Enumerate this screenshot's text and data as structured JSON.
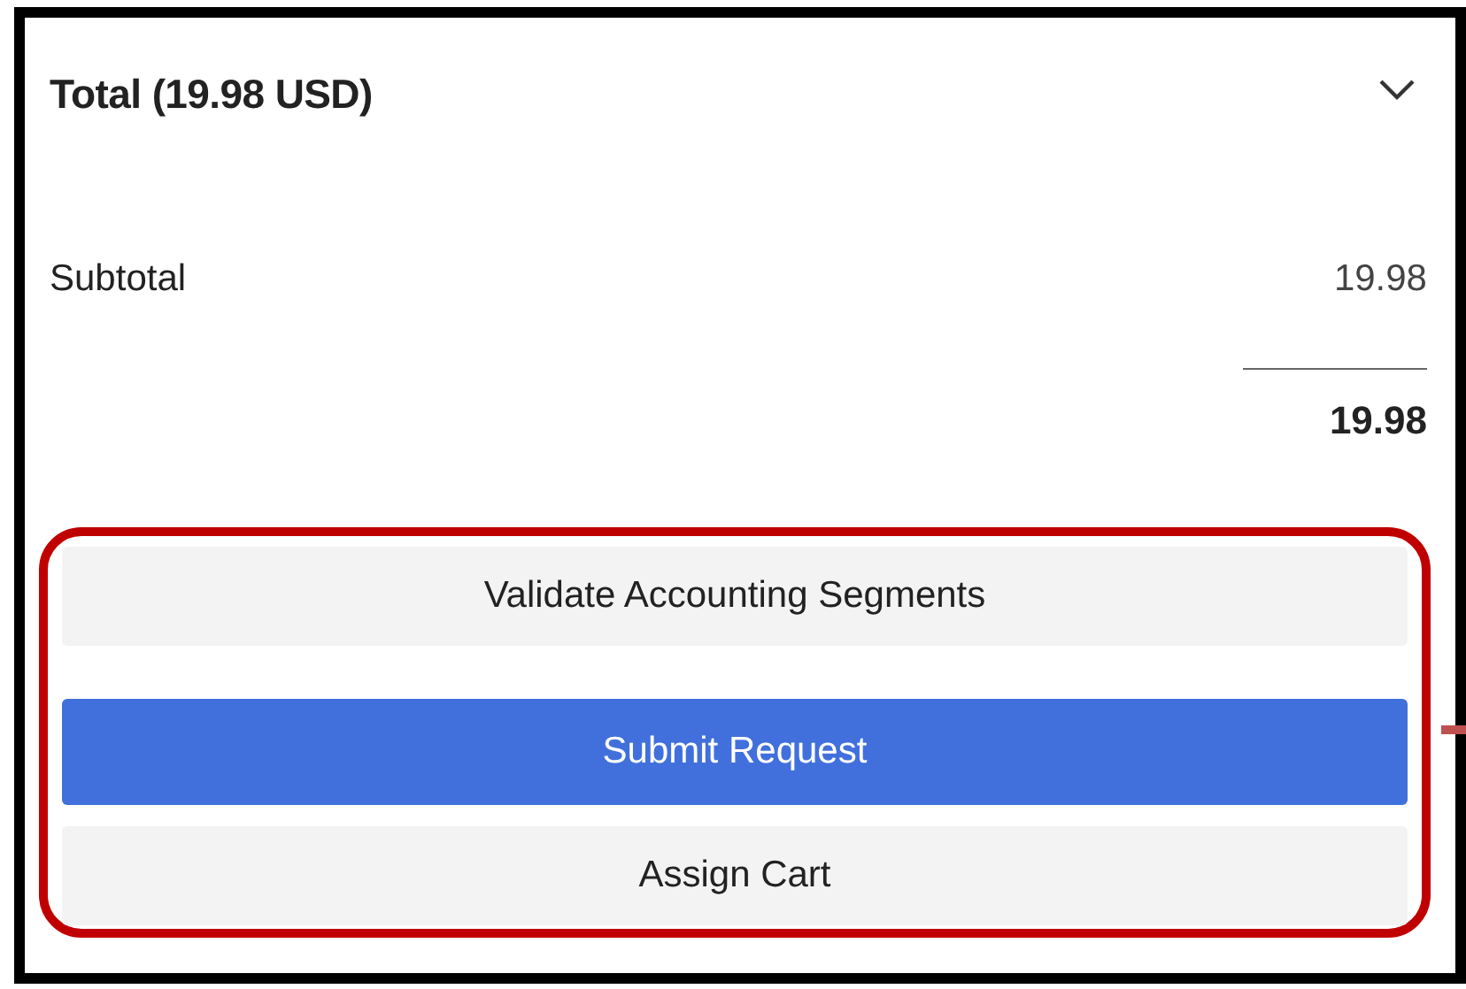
{
  "header": {
    "title": "Total (19.98 USD)",
    "expanded": true
  },
  "subtotal": {
    "label": "Subtotal",
    "value": "19.98"
  },
  "total": {
    "value": "19.98"
  },
  "buttons": [
    {
      "label": "Validate Accounting Segments",
      "kind": "secondary"
    },
    {
      "label": "Submit Request",
      "kind": "primary"
    },
    {
      "label": "Assign Cart",
      "kind": "secondary"
    }
  ]
}
